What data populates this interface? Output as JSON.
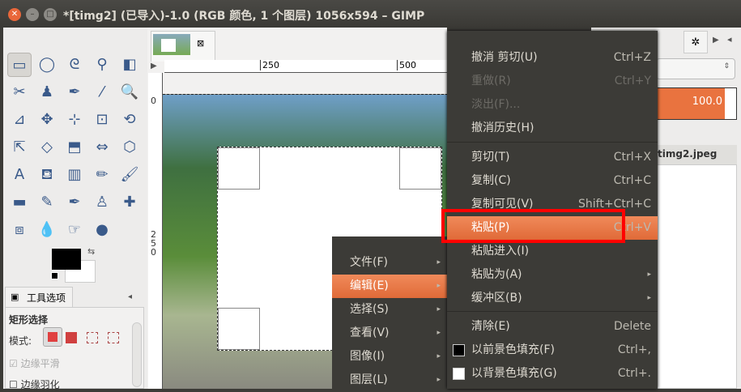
{
  "window": {
    "title": "*[timg2] (已导入)-1.0 (RGB 颜色, 1 个图层) 1056x594 – GIMP"
  },
  "ruler": {
    "h_ticks": [
      "250",
      "500"
    ],
    "v_ticks": [
      "0",
      "250"
    ]
  },
  "toolbox": {
    "tools": [
      "rect-select",
      "ellipse-select",
      "free-select",
      "fuzzy-select",
      "color-select",
      "scissors",
      "foreground-select",
      "paths",
      "color-picker",
      "zoom",
      "measure",
      "move",
      "align",
      "crop",
      "rotate",
      "scale",
      "shear",
      "perspective",
      "flip",
      "cage",
      "text",
      "bucket-fill",
      "blend",
      "pencil",
      "paintbrush",
      "eraser",
      "airbrush",
      "ink",
      "clone",
      "heal",
      "perspective-clone",
      "blur",
      "smudge",
      "dodge-burn"
    ],
    "fg_color": "#000000",
    "bg_color": "#ffffff",
    "options_tab": "工具选项",
    "options_title": "矩形选择",
    "mode_label": "模式:",
    "antialias_label": "边缘平滑",
    "feather_label": "边缘羽化"
  },
  "right_panel": {
    "opacity_value": "100.0",
    "layer_name": "timg2.jpeg",
    "accent": "#e9733f"
  },
  "context_menu": {
    "items": [
      {
        "label": "文件(F)"
      },
      {
        "label": "编辑(E)",
        "highlighted": true
      },
      {
        "label": "选择(S)"
      },
      {
        "label": "查看(V)"
      },
      {
        "label": "图像(I)"
      },
      {
        "label": "图层(L)"
      }
    ]
  },
  "edit_menu": {
    "items": [
      {
        "label": "撤消 剪切(U)",
        "shortcut": "Ctrl+Z"
      },
      {
        "label": "重做(R)",
        "shortcut": "Ctrl+Y",
        "disabled": true
      },
      {
        "label": "淡出(F)...",
        "shortcut": "",
        "disabled": true
      },
      {
        "label": "撤消历史(H)",
        "shortcut": ""
      },
      {
        "label": "剪切(T)",
        "shortcut": "Ctrl+X"
      },
      {
        "label": "复制(C)",
        "shortcut": "Ctrl+C"
      },
      {
        "label": "复制可见(V)",
        "shortcut": "Shift+Ctrl+C"
      },
      {
        "label": "粘贴(P)",
        "shortcut": "Ctrl+V",
        "highlighted": true
      },
      {
        "label": "粘贴进入(I)",
        "shortcut": ""
      },
      {
        "label": "粘贴为(A)",
        "shortcut": "",
        "submenu": true
      },
      {
        "label": "缓冲区(B)",
        "shortcut": "",
        "submenu": true
      },
      {
        "label": "清除(E)",
        "shortcut": "Delete"
      },
      {
        "label": "以前景色填充(F)",
        "shortcut": "Ctrl+,",
        "swatch": "#000000"
      },
      {
        "label": "以背景色填充(G)",
        "shortcut": "Ctrl+.",
        "swatch": "#ffffff"
      }
    ]
  },
  "highlight_box_color": "#ff0000"
}
